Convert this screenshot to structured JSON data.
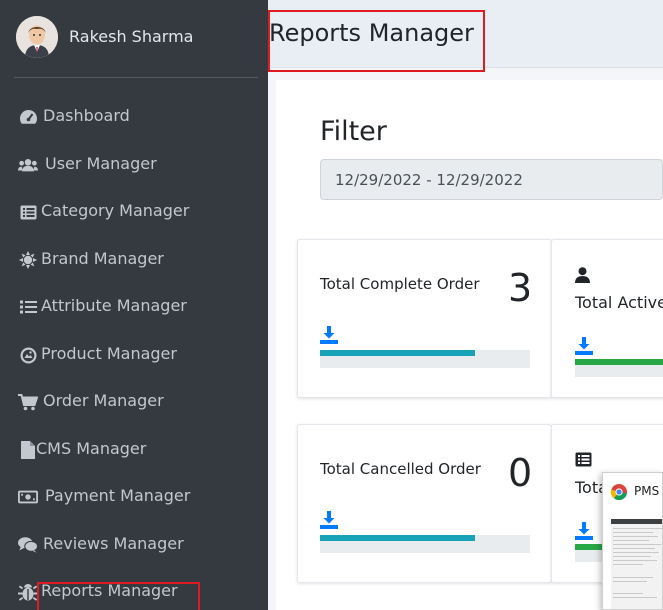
{
  "user": {
    "name": "Rakesh Sharma"
  },
  "sidebar": {
    "items": [
      {
        "label": "Dashboard",
        "icon": "tachometer-icon"
      },
      {
        "label": "User Manager",
        "icon": "users-icon"
      },
      {
        "label": "Category Manager",
        "icon": "list-alt-icon"
      },
      {
        "label": "Brand Manager",
        "icon": "sun-icon"
      },
      {
        "label": "Attribute Manager",
        "icon": "list-icon"
      },
      {
        "label": "Product Manager",
        "icon": "product-icon"
      },
      {
        "label": "Order Manager",
        "icon": "shopping-cart-icon"
      },
      {
        "label": "CMS Manager",
        "icon": "file-icon"
      },
      {
        "label": "Payment Manager",
        "icon": "money-bill-icon"
      },
      {
        "label": "Reviews Manager",
        "icon": "comments-icon"
      },
      {
        "label": "Reports Manager",
        "icon": "bug-icon"
      }
    ]
  },
  "header": {
    "title": "Reports Manager"
  },
  "filter": {
    "title": "Filter",
    "date_range": "12/29/2022 - 12/29/2022"
  },
  "stats": {
    "complete": {
      "label": "Total Complete Order",
      "value": "3",
      "progress": 0.74
    },
    "active": {
      "label": "Total Active",
      "progress": 1.0
    },
    "cancelled": {
      "label": "Total Cancelled Order",
      "value": "0",
      "progress": 0.74
    },
    "fourth": {
      "label": "Tota",
      "progress": 1.0
    }
  },
  "popup": {
    "title": "PMS -"
  },
  "colors": {
    "sidebar_bg": "#343a40",
    "accent_teal": "#17a2b8",
    "accent_green": "#28a745",
    "download_blue": "#007bff",
    "highlight_red": "#e01b24"
  }
}
